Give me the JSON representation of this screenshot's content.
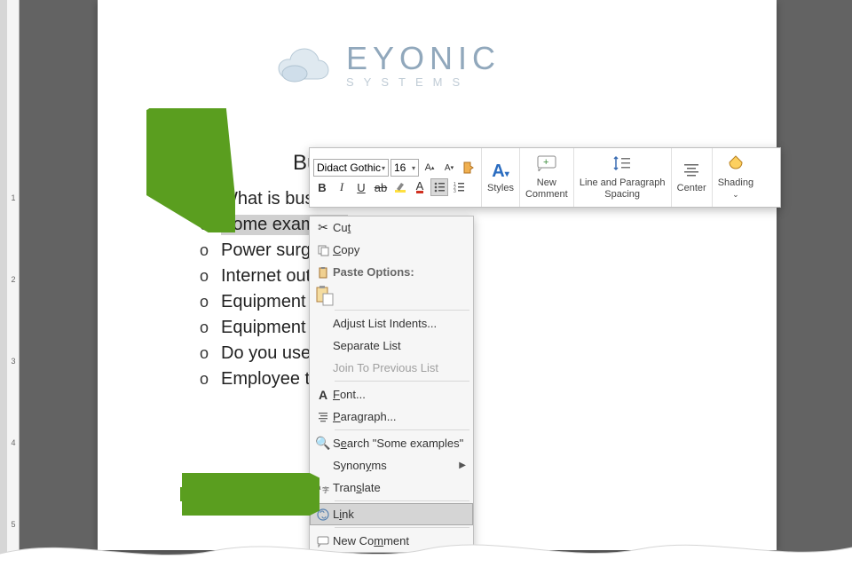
{
  "logo": {
    "main": "EYONIC",
    "sub": "SYSTEMS"
  },
  "heading_visible": "Bu",
  "bullets": [
    {
      "text": "What is busi",
      "full": "What is business…"
    },
    {
      "text": "Some examples",
      "selected": true,
      "cut_suffix": ""
    },
    {
      "text": "Power surge",
      "cut": true
    },
    {
      "text": "Internet out",
      "cut": true
    },
    {
      "text": "Equipment f",
      "cut": true
    },
    {
      "text": "Equipment r",
      "cut": true
    },
    {
      "text": "Do you use p",
      "cut": true
    },
    {
      "text": "Employee tu",
      "cut": true
    }
  ],
  "mini_toolbar": {
    "font": "Didact Gothic",
    "size": "16",
    "buttons_row1": [
      "A▲",
      "A▼",
      "format-painter"
    ],
    "styles": "Styles",
    "new_comment": "New Comment",
    "spacing": "Line and Paragraph Spacing",
    "center": "Center",
    "shading": "Shading",
    "btn_b": "B",
    "btn_i": "I",
    "btn_u": "U"
  },
  "context_menu": {
    "cut": "Cut",
    "copy": "Copy",
    "paste_options": "Paste Options:",
    "adjust_indents": "Adjust List Indents...",
    "separate_list": "Separate List",
    "join_prev": "Join To Previous List",
    "font": "Font...",
    "paragraph": "Paragraph...",
    "search": "Search \"Some examples\"",
    "synonyms": "Synonyms",
    "translate": "Translate",
    "link": "Link",
    "new_comment": "New Comment"
  }
}
